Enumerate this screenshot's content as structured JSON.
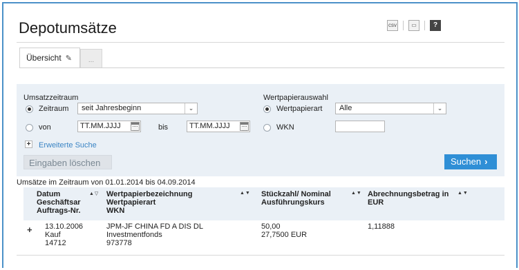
{
  "page": {
    "title": "Depotumsätze"
  },
  "toolbar": {
    "icons": [
      {
        "name": "csv-export-icon",
        "glyph": "csv"
      },
      {
        "name": "print-icon",
        "glyph": "▭"
      },
      {
        "name": "help-icon",
        "glyph": "?"
      }
    ]
  },
  "tabs": [
    {
      "label": "Übersicht",
      "icon": "pencil-icon"
    },
    {
      "label": "..."
    }
  ],
  "search": {
    "period_section": "Umsatzzeitraum",
    "period_radio": "Zeitraum",
    "period_select": "seit Jahresbeginn",
    "from_radio": "von",
    "from_value": "TT.MM.JJJJ",
    "to_label": "bis",
    "to_value": "TT.MM.JJJJ",
    "security_section": "Wertpapierauswahl",
    "type_radio": "Wertpapierart",
    "type_select": "Alle",
    "wkn_radio": "WKN",
    "wkn_value": "",
    "advanced": "Erweiterte Suche",
    "reset_button": "Eingaben löschen",
    "search_button": "Suchen"
  },
  "results": {
    "range_text": "Umsätze im Zeitraum von 01.01.2014 bis 04.09.2014",
    "columns": [
      [
        "Datum",
        "Geschäftsar",
        "Auftrags-Nr."
      ],
      [
        "Wertpapierbezeichnung",
        "Wertpapierart",
        "WKN"
      ],
      [
        "Stückzahl/ Nominal",
        "Ausführungskurs"
      ],
      [
        "Abrechnungsbetrag in",
        "EUR"
      ]
    ],
    "rows": [
      {
        "col1": [
          "13.10.2006",
          "Kauf",
          "14712"
        ],
        "col2": [
          "JPM-JF CHINA FD A DIS DL",
          "Investmentfonds",
          "973778"
        ],
        "col3": [
          "50,00",
          "27,7500 EUR"
        ],
        "col4": [
          "1,11888"
        ]
      }
    ]
  },
  "colors": {
    "accent": "#2f8fd6",
    "frame": "#4a90c8",
    "panel": "#eaf0f6"
  }
}
